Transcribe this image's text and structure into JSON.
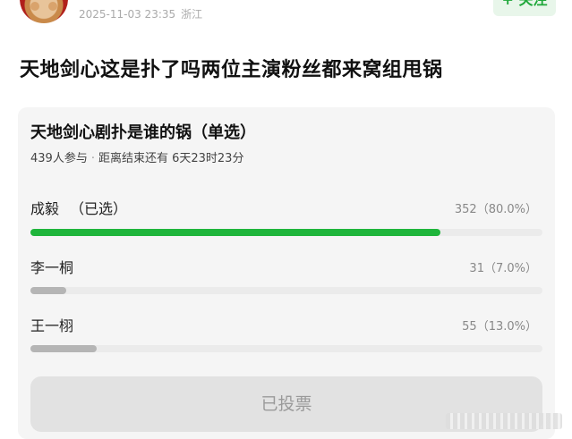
{
  "header": {
    "timestamp": "2025-11-03 23:35",
    "location": "浙江",
    "follow_label": "+ 关注"
  },
  "post": {
    "title": "天地剑心这是扑了吗两位主演粉丝都来窝组甩锅"
  },
  "poll": {
    "title": "天地剑心剧扑是谁的锅（单选）",
    "participants": "439人参与",
    "separator": "·",
    "time_left": "距离结束还有 6天23时23分",
    "options": [
      {
        "label": "成毅",
        "chosen_tag": "（已选）",
        "count": "352（80.0%）",
        "percent": 80.0,
        "color": "#1fb53b"
      },
      {
        "label": "李一桐",
        "chosen_tag": "",
        "count": "31（7.0%）",
        "percent": 7.0,
        "color": "#b5b5b5"
      },
      {
        "label": "王一栩",
        "chosen_tag": "",
        "count": "55（13.0%）",
        "percent": 13.0,
        "color": "#b5b5b5"
      }
    ],
    "vote_button_label": "已投票"
  }
}
